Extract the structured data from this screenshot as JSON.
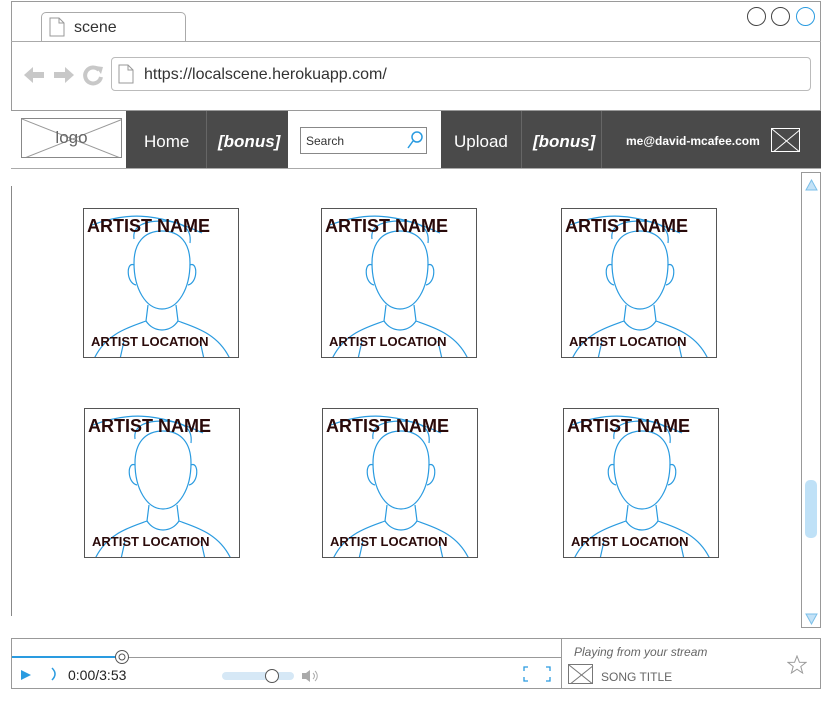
{
  "browser": {
    "tab_title": "scene",
    "url": "https://localscene.herokuapp.com/"
  },
  "nav": {
    "logo": "logo",
    "home": "Home",
    "bonus_left": "[bonus]",
    "search_placeholder": "Search",
    "upload": "Upload",
    "bonus_right": "[bonus]",
    "email": "me@david-mcafee.com"
  },
  "artists": [
    {
      "name": "ARTIST NAME",
      "location": "ARTIST LOCATION"
    },
    {
      "name": "ARTIST NAME",
      "location": "ARTIST LOCATION"
    },
    {
      "name": "ARTIST NAME",
      "location": "ARTIST LOCATION"
    },
    {
      "name": "ARTIST NAME",
      "location": "ARTIST LOCATION"
    },
    {
      "name": "ARTIST NAME",
      "location": "ARTIST LOCATION"
    },
    {
      "name": "ARTIST NAME",
      "location": "ARTIST LOCATION"
    }
  ],
  "player": {
    "time": "0:00/3:53",
    "progress_fraction": 0.2,
    "volume_fraction": 0.7,
    "playing_from": "Playing from your stream",
    "song_title": "SONG TITLE"
  },
  "colors": {
    "nav_bg": "#4a4a4a",
    "accent": "#2a9be0",
    "sketch_line": "#2a9be0"
  }
}
